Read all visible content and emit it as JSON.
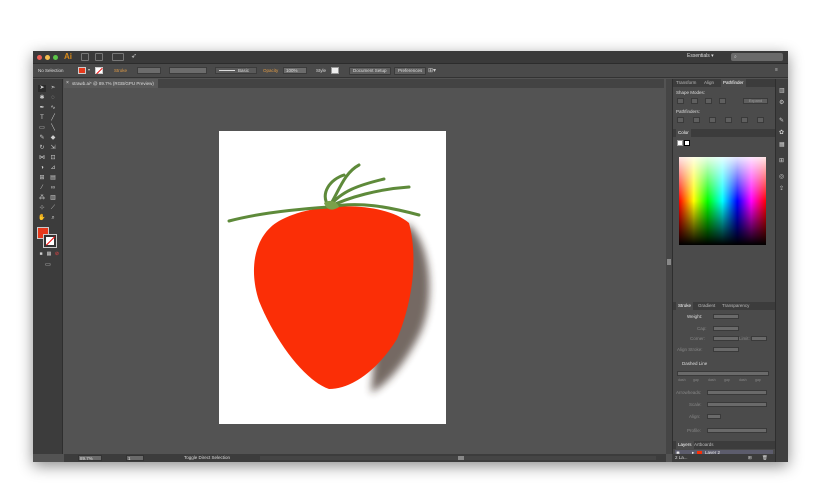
{
  "app": {
    "logo": "Ai",
    "workspace": "Essentials",
    "search_placeholder": "",
    "traffic_colors": [
      "#ee5f57",
      "#f4be4f",
      "#5bc548"
    ]
  },
  "control_bar": {
    "selection": "No Selection",
    "fill_color": "#e5391c",
    "stroke_label": "Stroke",
    "stroke_style": "Basic",
    "opacity_label": "Opacity",
    "opacity_value": "100%",
    "style_label": "Style",
    "document_setup": "Document Setup",
    "preferences": "Preferences"
  },
  "document": {
    "tab_title": "strawb.ai* @ 89.7% (RGB/GPU Preview)"
  },
  "artwork": {
    "strawberry_color": "#fb2e06",
    "stem_color": "#5e8a3a"
  },
  "status_bar": {
    "zoom": "89.7%",
    "artboard_number": "1",
    "status_text": "Toggle Direct Selection"
  },
  "panels": {
    "top_tabs": [
      "Transform",
      "Align",
      "Pathfinder"
    ],
    "shape_modes": "Shape Modes:",
    "expand": "Expand",
    "pathfinders": "Pathfinders:",
    "color_tab": "Color",
    "stroke_tabs": [
      "Stroke",
      "Gradient",
      "Transparency"
    ],
    "weight_label": "Weight:",
    "cap_label": "Cap:",
    "corner_label": "Corner:",
    "limit_label": "Limit:",
    "align_stroke_label": "Align Stroke:",
    "dashed_line": "Dashed Line",
    "dash_labels": [
      "dash",
      "gap",
      "dash",
      "gap",
      "dash",
      "gap"
    ],
    "arrowheads_label": "Arrowheads:",
    "scale_label": "Scale:",
    "align_label": "Align:",
    "profile_label": "Profile:",
    "layers_tabs": [
      "Layers",
      "Artboards"
    ],
    "layers": [
      "Layer 2",
      "Layer 1"
    ],
    "layer_count": "2 La..."
  }
}
